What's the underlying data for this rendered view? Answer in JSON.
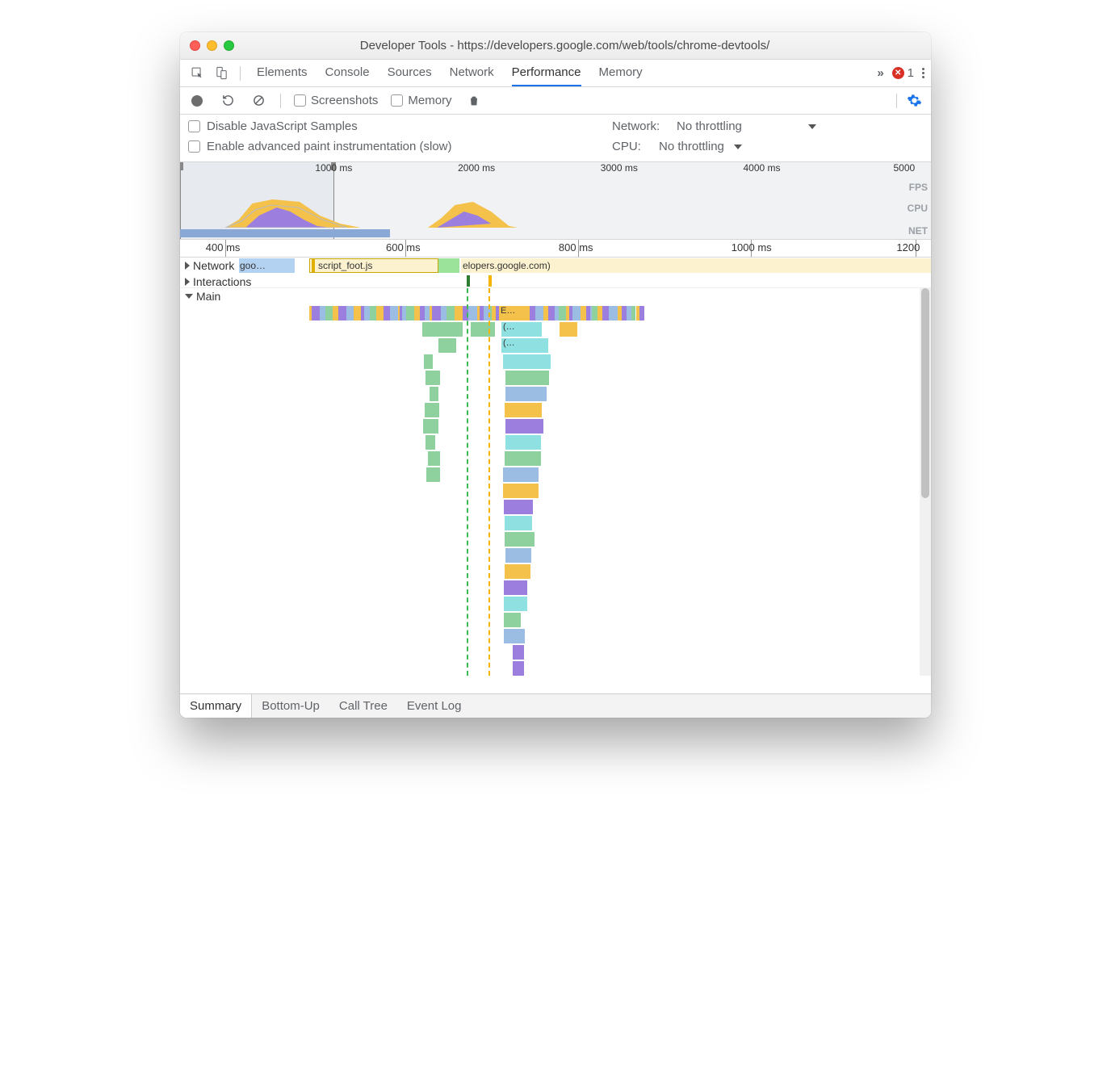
{
  "window": {
    "title": "Developer Tools - https://developers.google.com/web/tools/chrome-devtools/"
  },
  "devtabs": {
    "tabs": [
      "Elements",
      "Console",
      "Sources",
      "Network",
      "Performance",
      "Memory"
    ],
    "activeIndex": 4,
    "overflowGlyph": "»",
    "errorCount": "1"
  },
  "perfbar": {
    "screenshots": "Screenshots",
    "memory": "Memory"
  },
  "settings": {
    "disableJS": "Disable JavaScript Samples",
    "enablePaint": "Enable advanced paint instrumentation (slow)",
    "networkLabel": "Network:",
    "networkValue": "No throttling",
    "cpuLabel": "CPU:",
    "cpuValue": "No throttling"
  },
  "overview": {
    "ticks": [
      {
        "label": "1000 ms",
        "pct": 18
      },
      {
        "label": "2000 ms",
        "pct": 37
      },
      {
        "label": "3000 ms",
        "pct": 56
      },
      {
        "label": "4000 ms",
        "pct": 75
      },
      {
        "label": "5000",
        "pct": 95
      }
    ],
    "labels": {
      "fps": "FPS",
      "cpu": "CPU",
      "net": "NET"
    },
    "selection": {
      "leftPct": 0,
      "rightPct": 20.5
    }
  },
  "ruler": {
    "ticks": [
      {
        "label": "400 ms",
        "pct": 6
      },
      {
        "label": "600 ms",
        "pct": 30
      },
      {
        "label": "800 ms",
        "pct": 53
      },
      {
        "label": "1000 ms",
        "pct": 76
      },
      {
        "label": "1200",
        "pct": 98
      }
    ]
  },
  "tracks": {
    "network": "Network",
    "net_items": [
      {
        "label": "goo…",
        "leftPct": 3,
        "widthPct": 6,
        "color": "#b3d1f0"
      },
      {
        "label": "script_foot.js",
        "leftPct": 12,
        "widthPct": 23,
        "color": "#fdf2d0",
        "border": "#e0b000"
      },
      {
        "label": "elopers.google.com)",
        "leftPct": 37,
        "widthPct": 63,
        "color": "#fdf2d0"
      }
    ],
    "small_green": {
      "leftPct": 33,
      "widthPct": 3
    },
    "interactions": "Interactions",
    "main": "Main",
    "markers": [
      {
        "pct": 35.5,
        "color": "#3cba54"
      },
      {
        "pct": 39.2,
        "color": "#f4b400"
      }
    ],
    "flame_top": [
      {
        "l": 15,
        "w": 50,
        "c": "mix"
      }
    ],
    "flame_labels": {
      "e": "E…",
      "p1": "(…",
      "p2": "(…"
    }
  },
  "detailtabs": {
    "tabs": [
      "Summary",
      "Bottom-Up",
      "Call Tree",
      "Event Log"
    ],
    "activeIndex": 0
  },
  "colors": {
    "script": "#f4c24a",
    "render": "#9b7ede",
    "paint": "#8fd19e",
    "system": "#9bbce3",
    "idle": "#ddd",
    "teal": "#8fe0e0"
  }
}
